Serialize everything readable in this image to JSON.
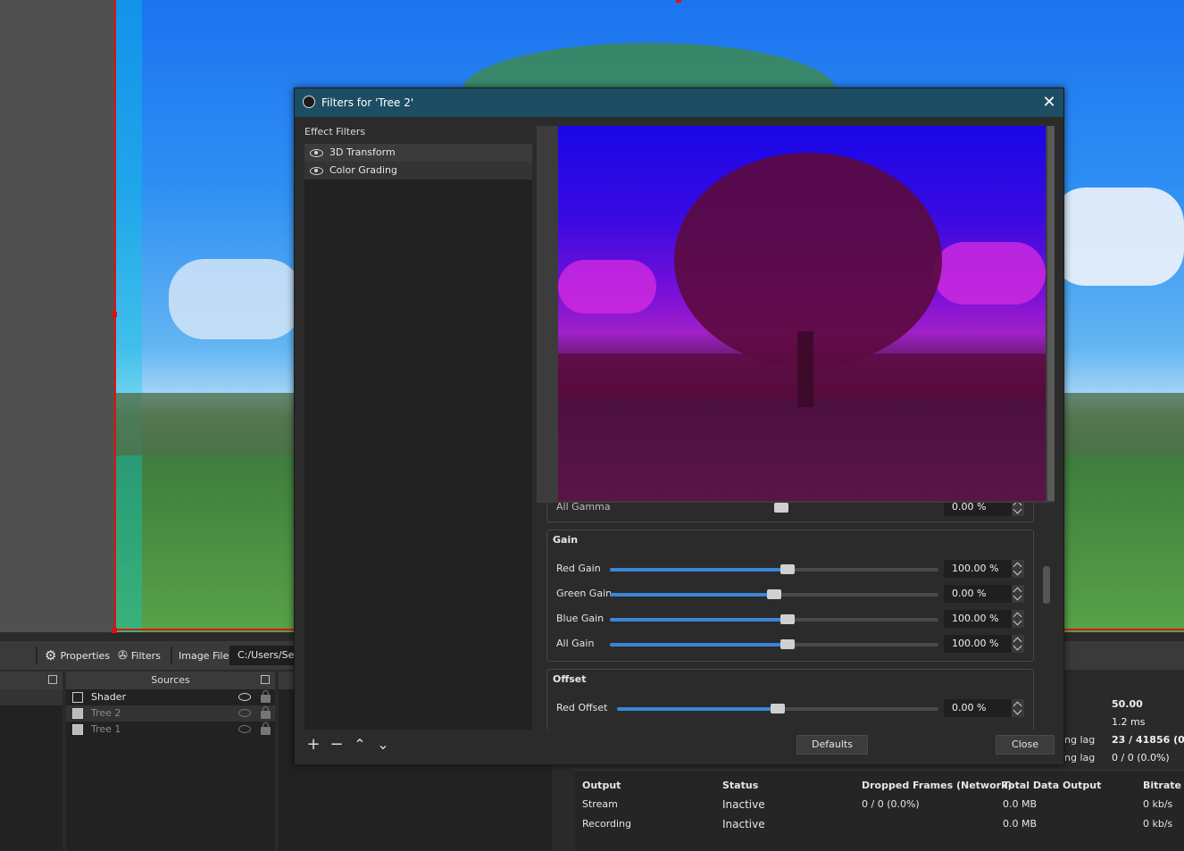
{
  "toolbar": {
    "properties_label": "Properties",
    "filters_label": "Filters",
    "source_type": "Image File",
    "path": "C:/Users/Seb"
  },
  "sources_dock": {
    "title": "Sources",
    "items": [
      {
        "name": "Shader",
        "visible": true,
        "locked": false
      },
      {
        "name": "Tree 2",
        "visible": false,
        "locked": false
      },
      {
        "name": "Tree 1",
        "visible": false,
        "locked": false
      }
    ]
  },
  "stats": {
    "fps": "50.00",
    "frame_time": "1.2 ms",
    "lag1_label": "ng lag",
    "lag1_value": "23 / 41856 (0.",
    "lag2_label": "ng lag",
    "lag2_value": "0 / 0 (0.0%)"
  },
  "output_table": {
    "headers": [
      "Output",
      "Status",
      "Dropped Frames (Network)",
      "Total Data Output",
      "Bitrate"
    ],
    "rows": [
      [
        "Stream",
        "Inactive",
        "0 / 0 (0.0%)",
        "0.0 MB",
        "0 kb/s"
      ],
      [
        "Recording",
        "Inactive",
        "",
        "0.0 MB",
        "0 kb/s"
      ]
    ]
  },
  "dialog": {
    "title": "Filters for 'Tree 2'",
    "effect_filters_label": "Effect Filters",
    "filters": [
      {
        "name": "3D Transform",
        "enabled": true
      },
      {
        "name": "Color Grading",
        "enabled": true
      }
    ],
    "list_buttons": {
      "add": "+",
      "remove": "−",
      "up": "⌃",
      "down": "⌄"
    },
    "defaults_label": "Defaults",
    "close_label": "Close",
    "partial_row": {
      "label": "All Gamma",
      "value": "0.00 %"
    },
    "gain": {
      "title": "Gain",
      "rows": [
        {
          "label": "Red Gain",
          "value": "100.00 %",
          "level": 0.54
        },
        {
          "label": "Green Gain",
          "value": "0.00 %",
          "level": 0.5
        },
        {
          "label": "Blue Gain",
          "value": "100.00 %",
          "level": 0.54
        },
        {
          "label": "All Gain",
          "value": "100.00 %",
          "level": 0.54
        }
      ]
    },
    "offset": {
      "title": "Offset",
      "rows": [
        {
          "label": "Red Offset",
          "value": "0.00 %",
          "level": 0.5
        }
      ]
    }
  },
  "colors": {
    "titlebar": "#1d4d63",
    "accent": "#3a87d8",
    "selection_border": "#e01010"
  }
}
